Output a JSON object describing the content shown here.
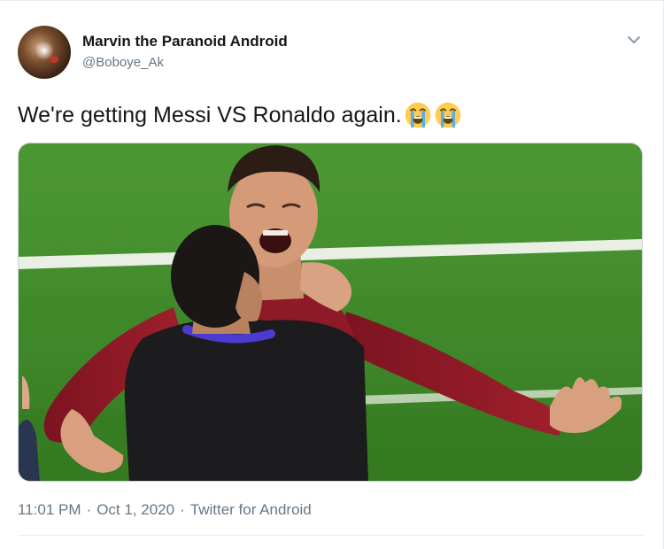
{
  "user": {
    "display_name": "Marvin the Paranoid Android",
    "handle": "@Boboye_Ak",
    "avatar_icon": "avatar-photo"
  },
  "tweet": {
    "text": "We're getting Messi VS Ronaldo again.",
    "emojis": [
      "loudly-crying-face-icon",
      "loudly-crying-face-icon"
    ]
  },
  "media": {
    "icon": "photo-two-men-embracing-on-football-pitch"
  },
  "meta": {
    "time": "11:01 PM",
    "date": "Oct 1, 2020",
    "separator": "·",
    "source": "Twitter for Android"
  },
  "colors": {
    "text_primary": "#14171a",
    "text_secondary": "#657786",
    "border": "#e6ecf0",
    "pitch_green": "#3f8a2a"
  }
}
